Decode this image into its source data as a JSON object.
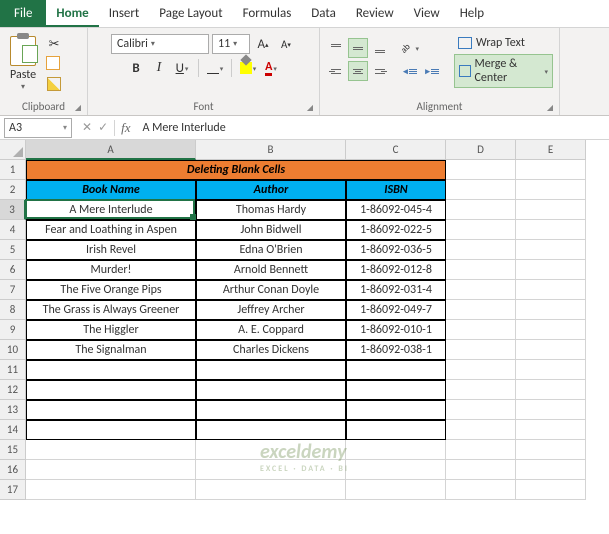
{
  "menu": {
    "file": "File",
    "tabs": [
      "Home",
      "Insert",
      "Page Layout",
      "Formulas",
      "Data",
      "Review",
      "View",
      "Help"
    ],
    "active": "Home"
  },
  "ribbon": {
    "clipboard": {
      "label": "Clipboard",
      "paste": "Paste"
    },
    "font": {
      "label": "Font",
      "name": "Calibri",
      "size": "11",
      "bold": "B",
      "italic": "I",
      "underline": "U",
      "grow": "A",
      "shrink": "A",
      "fontcolor": "A"
    },
    "alignment": {
      "label": "Alignment",
      "wrap": "Wrap Text",
      "merge": "Merge & Center"
    }
  },
  "formula_bar": {
    "cell_ref": "A3",
    "value": "A Mere Interlude",
    "cancel": "✕",
    "enter": "✓",
    "fx": "fx"
  },
  "columns": [
    "A",
    "B",
    "C",
    "D",
    "E"
  ],
  "rows": [
    1,
    2,
    3,
    4,
    5,
    6,
    7,
    8,
    9,
    10,
    11,
    12,
    13,
    14,
    15,
    16,
    17
  ],
  "sheet": {
    "title": "Deleting Blank Cells",
    "headers": [
      "Book Name",
      "Author",
      "ISBN"
    ],
    "data": [
      {
        "book": "A Mere Interlude",
        "author": "Thomas Hardy",
        "isbn": "1-86092-045-4"
      },
      {
        "book": "Fear and Loathing in Aspen",
        "author": "John Bidwell",
        "isbn": "1-86092-022-5"
      },
      {
        "book": "Irish Revel",
        "author": "Edna O'Brien",
        "isbn": "1-86092-036-5"
      },
      {
        "book": "Murder!",
        "author": "Arnold Bennett",
        "isbn": "1-86092-012-8"
      },
      {
        "book": "The Five Orange Pips",
        "author": "Arthur Conan Doyle",
        "isbn": "1-86092-031-4"
      },
      {
        "book": "The Grass is Always Greener",
        "author": "Jeffrey Archer",
        "isbn": "1-86092-049-7"
      },
      {
        "book": "The Higgler",
        "author": "A. E. Coppard",
        "isbn": "1-86092-010-1"
      },
      {
        "book": "The Signalman",
        "author": "Charles Dickens",
        "isbn": "1-86092-038-1"
      }
    ]
  },
  "watermark": {
    "main": "exceldemy",
    "sub": "EXCEL · DATA · BI"
  }
}
